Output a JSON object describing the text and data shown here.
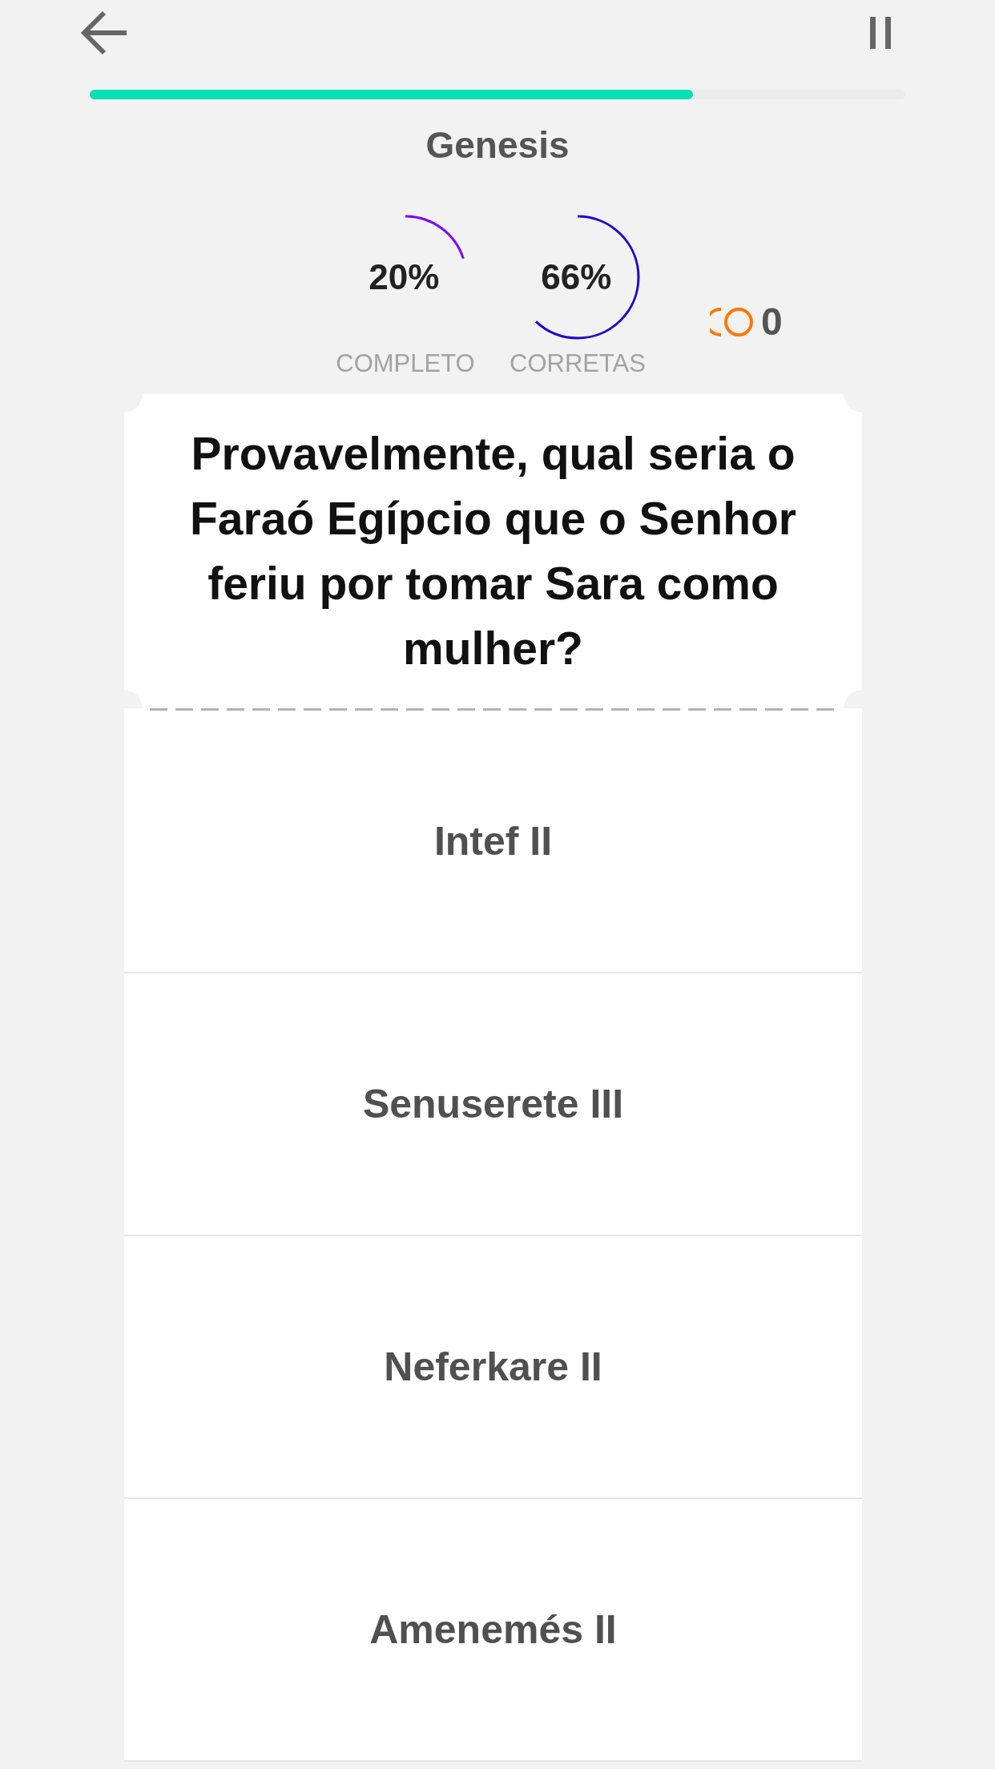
{
  "progress": {
    "level": 0.74
  },
  "title": "Genesis",
  "stats": [
    {
      "value": "20%",
      "label": "COMPLETO",
      "level": 0.2,
      "color": "#7f00ff"
    },
    {
      "value": "66%",
      "label": "CORRETAS",
      "level": 0.62,
      "color": "#2200cc"
    }
  ],
  "coins": {
    "count": "0"
  },
  "question": {
    "text": "Provavelmente, qual seria o Faraó Egípcio que o Senhor feriu por tomar Sara como mulher?"
  },
  "answers": [
    {
      "text": "Intef II",
      "selected": false
    },
    {
      "text": "Senuserete III",
      "selected": false
    },
    {
      "text": "Neferkare II",
      "selected": false
    },
    {
      "text": "Amenemés II",
      "selected": false
    }
  ]
}
